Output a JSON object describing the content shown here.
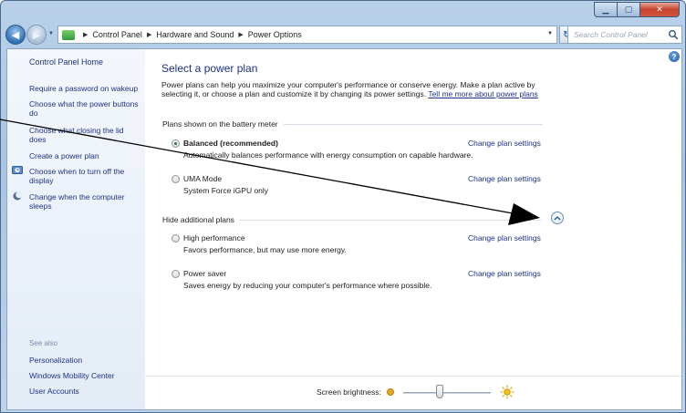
{
  "window": {
    "caption_buttons": [
      "minimize",
      "maximize",
      "close"
    ]
  },
  "address_bar": {
    "breadcrumbs": [
      "Control Panel",
      "Hardware and Sound",
      "Power Options"
    ],
    "search_placeholder": "Search Control Panel"
  },
  "sidebar": {
    "home": "Control Panel Home",
    "links": [
      "Require a password on wakeup",
      "Choose what the power buttons do",
      "Choose what closing the lid does",
      "Create a power plan",
      "Choose when to turn off the display",
      "Change when the computer sleeps"
    ],
    "see_also_label": "See also",
    "see_also": [
      "Personalization",
      "Windows Mobility Center",
      "User Accounts"
    ]
  },
  "main": {
    "title": "Select a power plan",
    "description": "Power plans can help you maximize your computer's performance or conserve energy. Make a plan active by selecting it, or choose a plan and customize it by changing its power settings.",
    "tell_me_link": "Tell me more about power plans",
    "battery_meter_header": "Plans shown on the battery meter",
    "additional_header": "Hide additional plans",
    "change_link": "Change plan settings",
    "plans": [
      {
        "name": "Balanced (recommended)",
        "description": "Automatically balances performance with energy consumption on capable hardware.",
        "selected": true
      },
      {
        "name": "UMA Mode",
        "description": "System Force iGPU only",
        "selected": false
      },
      {
        "name": "High performance",
        "description": "Favors performance, but may use more energy.",
        "selected": false
      },
      {
        "name": "Power saver",
        "description": "Saves energy by reducing your computer's performance where possible.",
        "selected": false
      }
    ],
    "brightness_label": "Screen brightness:",
    "brightness_level": 0.42
  },
  "colors": {
    "link": "#1e3287",
    "annotation_arrow": "#000000"
  }
}
